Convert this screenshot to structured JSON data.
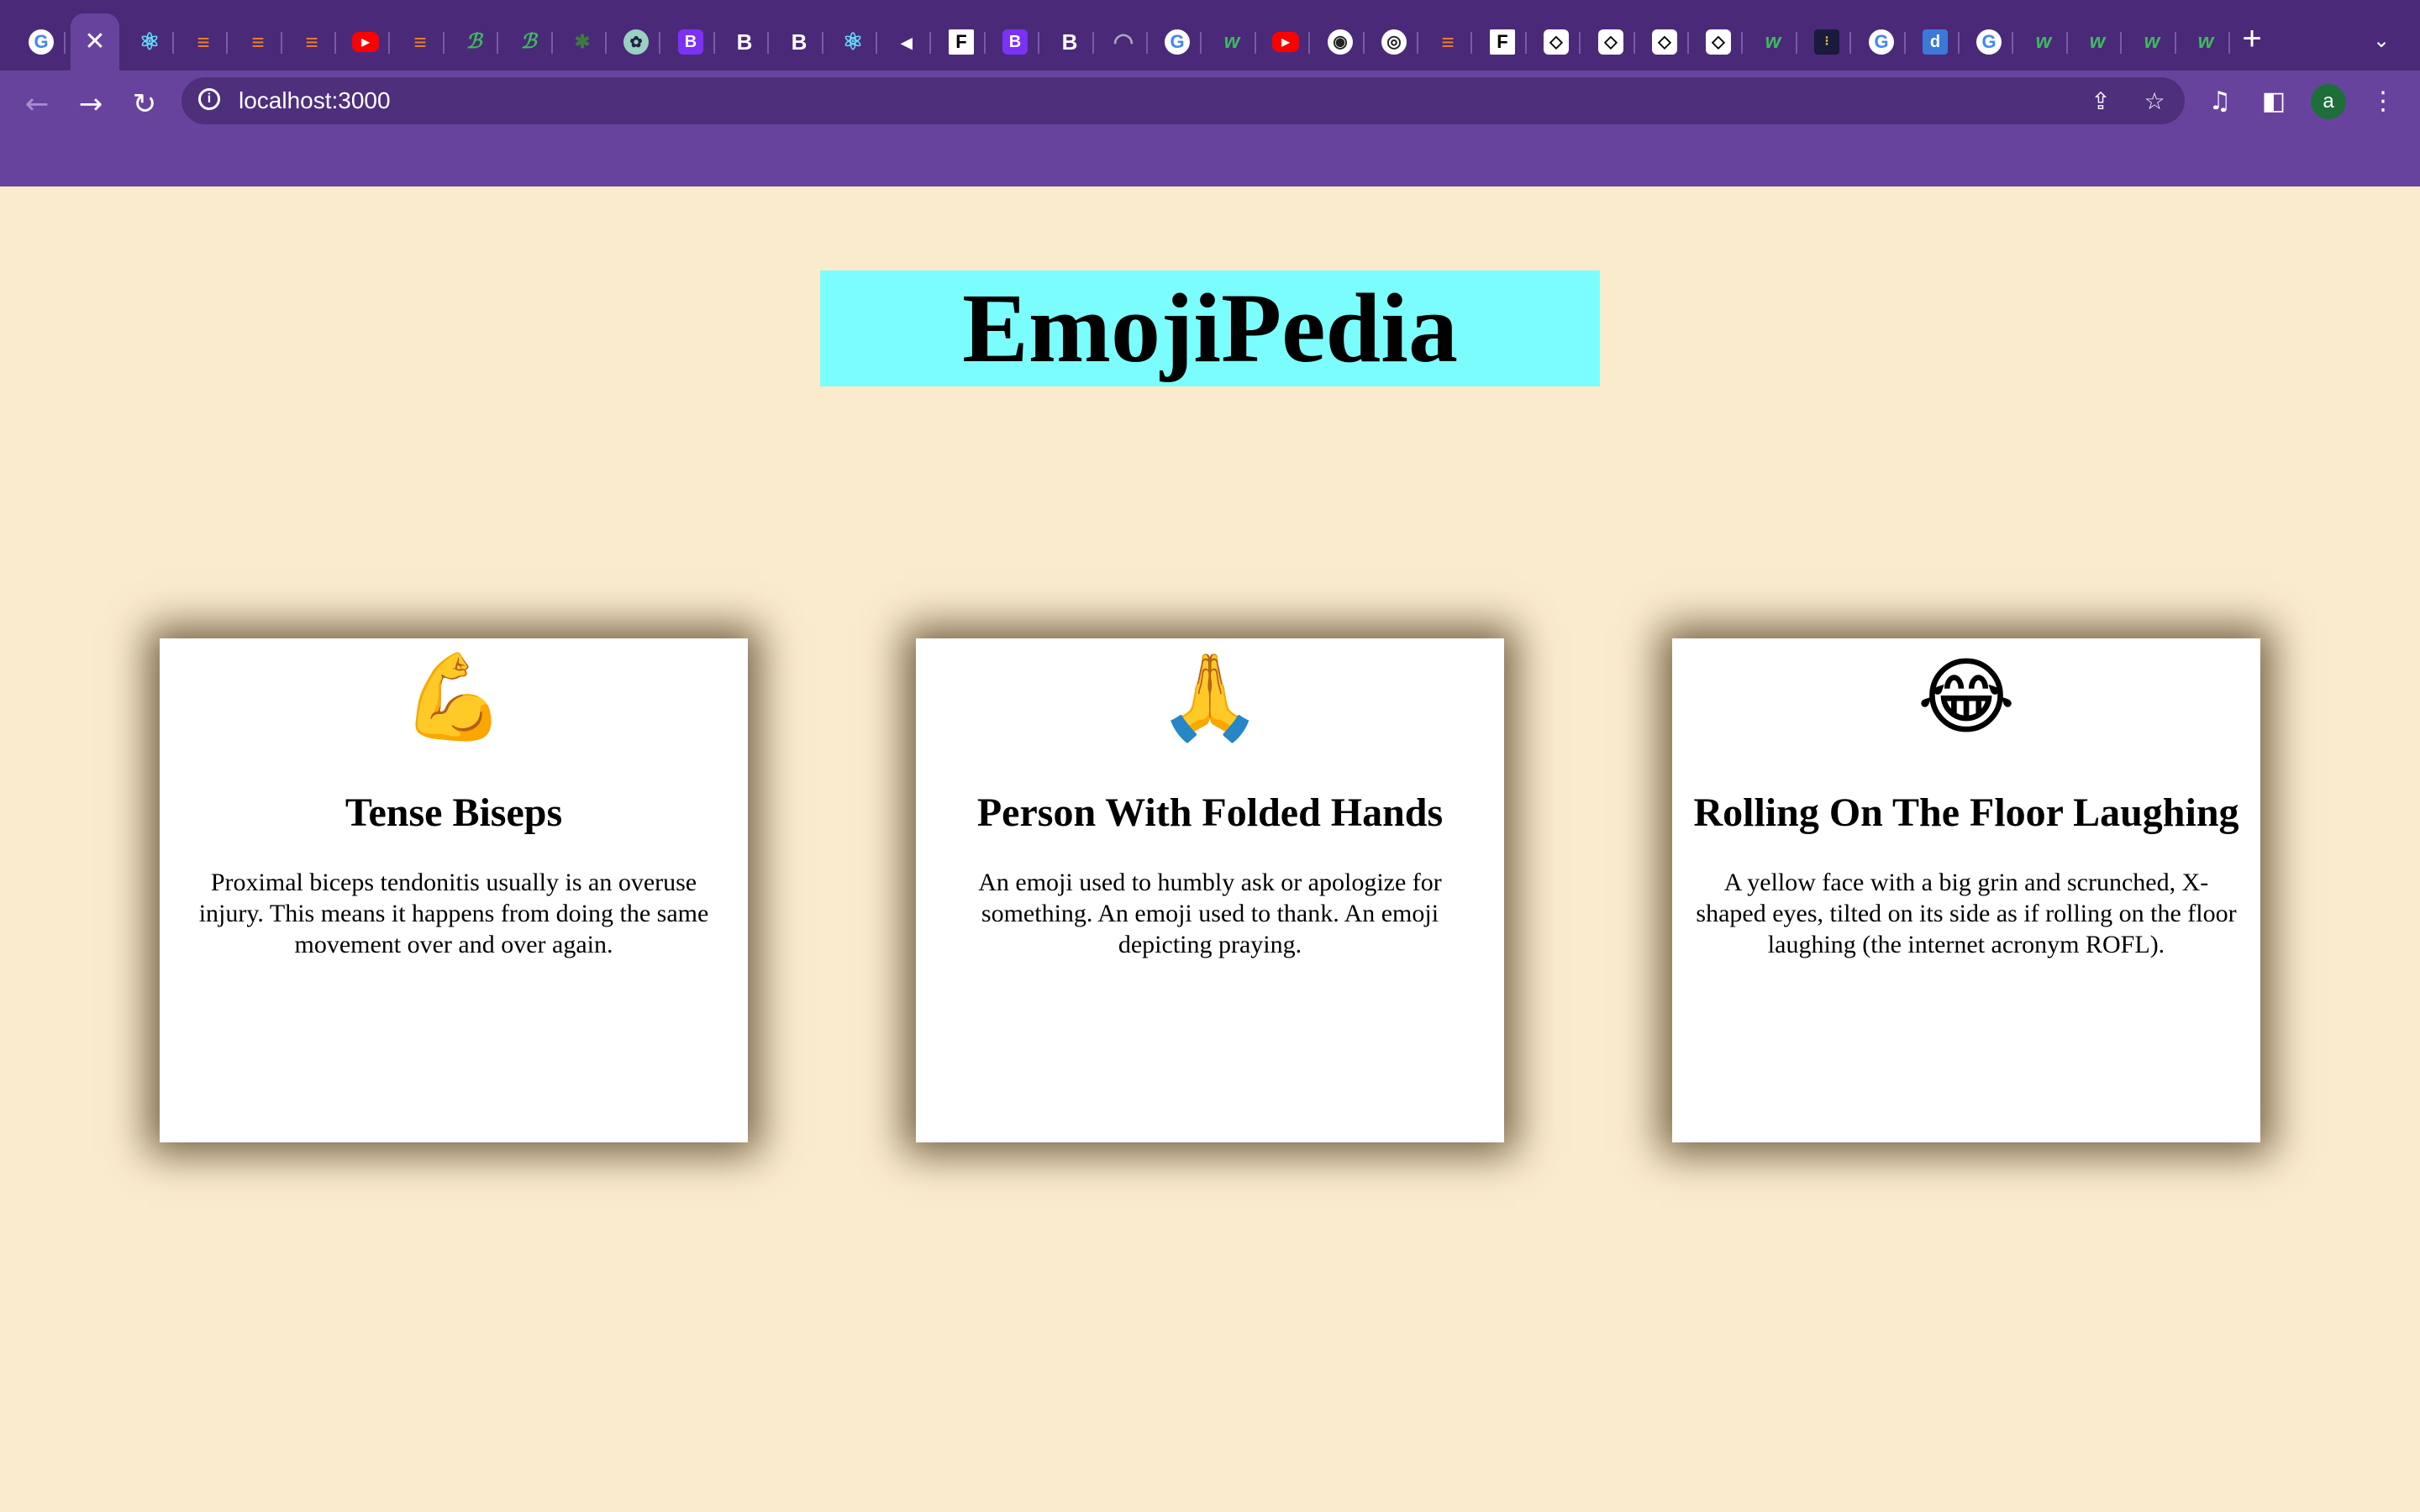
{
  "browser": {
    "tabs": [
      {
        "icon": "google-icon",
        "glyph": "G",
        "style": "g"
      },
      {
        "icon": "close-icon",
        "glyph": "✕",
        "style": "close",
        "active": true
      },
      {
        "icon": "react-icon",
        "glyph": "⚛",
        "style": "re"
      },
      {
        "icon": "stackoverflow-icon",
        "glyph": "≡",
        "style": "so"
      },
      {
        "icon": "stackoverflow-icon",
        "glyph": "≡",
        "style": "so"
      },
      {
        "icon": "stackoverflow-icon",
        "glyph": "≡",
        "style": "so"
      },
      {
        "icon": "youtube-icon",
        "glyph": "▶",
        "style": "yt"
      },
      {
        "icon": "stackoverflow-icon",
        "glyph": "≡",
        "style": "so"
      },
      {
        "icon": "colorful-b-icon",
        "glyph": "ℬ",
        "style": "w3"
      },
      {
        "icon": "colorful-b-icon",
        "glyph": "ℬ",
        "style": "w3"
      },
      {
        "icon": "grid-icon",
        "glyph": "✱",
        "style": "gr"
      },
      {
        "icon": "chatgpt-icon",
        "glyph": "✿",
        "style": "gp"
      },
      {
        "icon": "bootstrap-icon",
        "glyph": "B",
        "style": "bs"
      },
      {
        "icon": "bold-b-icon",
        "glyph": "B",
        "style": "bw"
      },
      {
        "icon": "bold-b-icon",
        "glyph": "B",
        "style": "bw"
      },
      {
        "icon": "react-icon",
        "glyph": "⚛",
        "style": "re"
      },
      {
        "icon": "speaker-icon",
        "glyph": "◂",
        "style": "bw"
      },
      {
        "icon": "f-logo-icon",
        "glyph": "F",
        "style": "fi"
      },
      {
        "icon": "bootstrap-icon",
        "glyph": "B",
        "style": "bs"
      },
      {
        "icon": "bold-b-icon",
        "glyph": "B",
        "style": "bw"
      },
      {
        "icon": "loading-spinner-icon",
        "glyph": "◠",
        "style": "sp"
      },
      {
        "icon": "google-icon",
        "glyph": "G",
        "style": "g"
      },
      {
        "icon": "w3-icon",
        "glyph": "w",
        "style": "w3"
      },
      {
        "icon": "youtube-icon",
        "glyph": "▶",
        "style": "yt"
      },
      {
        "icon": "globe-icon",
        "glyph": "◉",
        "style": "dk"
      },
      {
        "icon": "chrome-icon",
        "glyph": "◎",
        "style": "dk"
      },
      {
        "icon": "stackoverflow-icon",
        "glyph": "≡",
        "style": "so"
      },
      {
        "icon": "f-logo-icon",
        "glyph": "F",
        "style": "fi"
      },
      {
        "icon": "codepen-icon",
        "glyph": "◇",
        "style": "cp"
      },
      {
        "icon": "codepen-icon",
        "glyph": "◇",
        "style": "cp"
      },
      {
        "icon": "codepen-icon",
        "glyph": "◇",
        "style": "cp"
      },
      {
        "icon": "codepen-icon",
        "glyph": "◇",
        "style": "cp"
      },
      {
        "icon": "w3-icon",
        "glyph": "w",
        "style": "w3"
      },
      {
        "icon": "calculator-icon",
        "glyph": "⁝",
        "style": "ca"
      },
      {
        "icon": "google-icon",
        "glyph": "G",
        "style": "g"
      },
      {
        "icon": "d-logo-icon",
        "glyph": "d",
        "style": "db"
      },
      {
        "icon": "google-icon",
        "glyph": "G",
        "style": "g"
      },
      {
        "icon": "w3-icon",
        "glyph": "w",
        "style": "w3"
      },
      {
        "icon": "w3-icon",
        "glyph": "w",
        "style": "w3"
      },
      {
        "icon": "w3-icon",
        "glyph": "w",
        "style": "w3"
      },
      {
        "icon": "w3-icon",
        "glyph": "w",
        "style": "w3"
      }
    ],
    "new_tab_glyph": "+",
    "tab_menu_glyph": "⌄",
    "back_glyph": "←",
    "forward_glyph": "→",
    "reload_glyph": "↻",
    "info_glyph": "i",
    "url": "localhost:3000",
    "share_glyph": "⇪",
    "bookmark_glyph": "☆",
    "media_glyph": "♫",
    "sidepanel_glyph": "◧",
    "avatar_letter": "a",
    "menu_glyph": "⋮"
  },
  "colors": {
    "page_background": "#fbebcd",
    "title_background": "#7cfdfd",
    "browser_frame": "#68439e",
    "card_background": "#ffffff"
  },
  "page": {
    "title": "EmojiPedia",
    "cards": [
      {
        "emoji": "💪",
        "name": "Tense Biseps",
        "description": "Proximal biceps tendonitis usually is an overuse injury. This means it happens from doing the same movement over and over again."
      },
      {
        "emoji": "🙏",
        "name": "Person With Folded Hands",
        "description": "An emoji used to humbly ask or apologize for something. An emoji used to thank. An emoji depicting praying."
      },
      {
        "emoji": "😂",
        "name": "Rolling On The Floor Laughing",
        "description": "A yellow face with a big grin and scrunched, X-shaped eyes, tilted on its side as if rolling on the floor laughing (the internet acronym ROFL)."
      }
    ]
  }
}
